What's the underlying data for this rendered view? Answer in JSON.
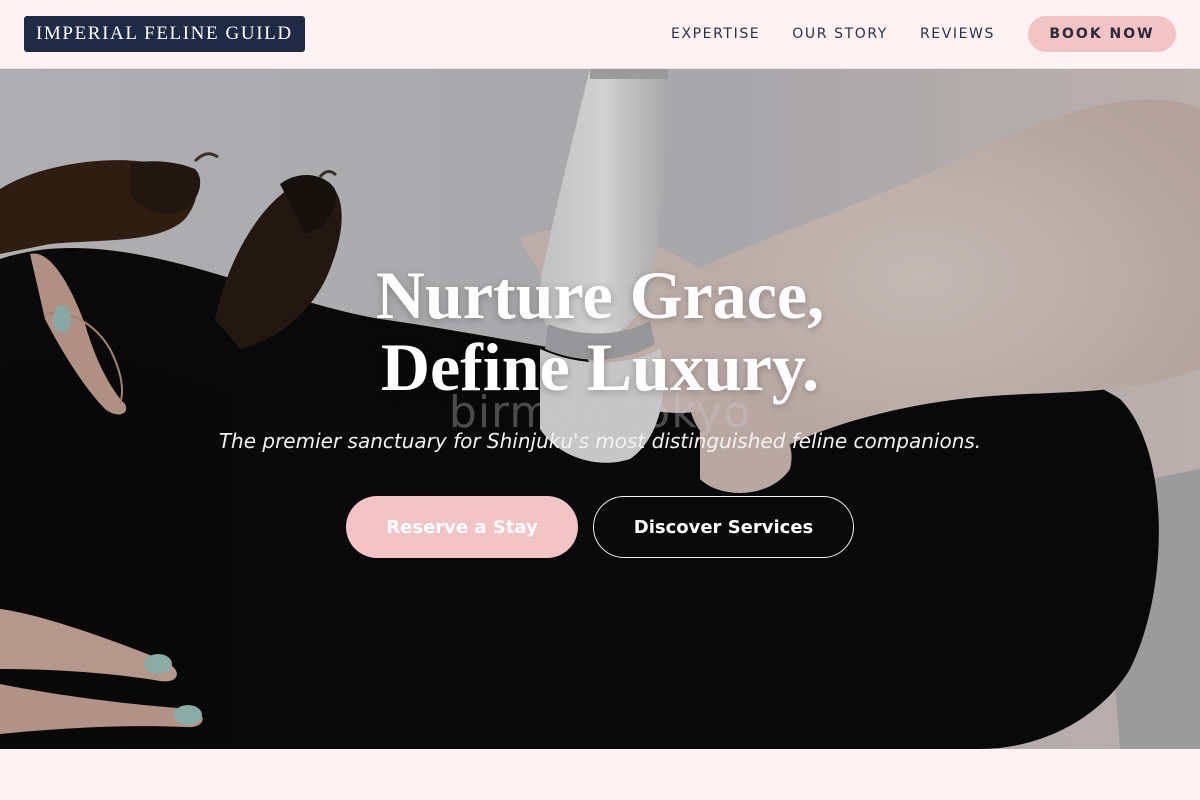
{
  "header": {
    "logo": "IMPERIAL FELINE GUILD",
    "nav": [
      "EXPERTISE",
      "OUR STORY",
      "REVIEWS"
    ],
    "cta": "BOOK NOW"
  },
  "hero": {
    "title_line1": "Nurture Grace,",
    "title_line2": "Define Luxury.",
    "watermark": "birman.tokyo",
    "subtitle": "The premier sanctuary for Shinjuku's most distinguished feline companions.",
    "primary_cta": "Reserve a Stay",
    "secondary_cta": "Discover Services"
  },
  "colors": {
    "logo_bg": "#1f2a44",
    "accent_pink": "#f2c4c6",
    "page_bg": "#fdf3f5"
  }
}
